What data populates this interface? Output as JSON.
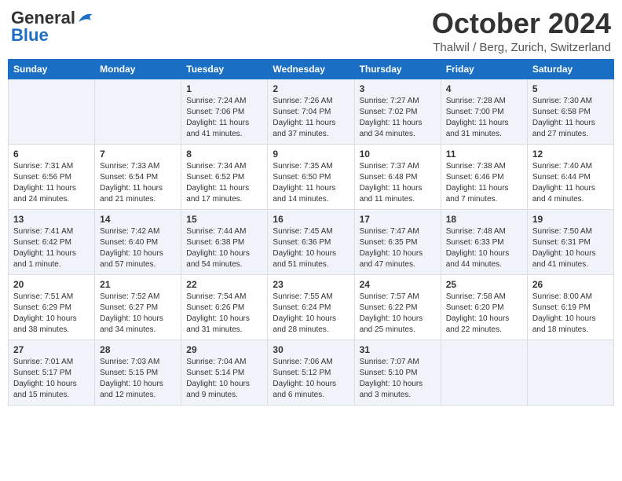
{
  "logo": {
    "general": "General",
    "blue": "Blue"
  },
  "title": "October 2024",
  "location": "Thalwil / Berg, Zurich, Switzerland",
  "days_of_week": [
    "Sunday",
    "Monday",
    "Tuesday",
    "Wednesday",
    "Thursday",
    "Friday",
    "Saturday"
  ],
  "weeks": [
    [
      {
        "day": "",
        "info": ""
      },
      {
        "day": "",
        "info": ""
      },
      {
        "day": "1",
        "info": "Sunrise: 7:24 AM\nSunset: 7:06 PM\nDaylight: 11 hours and 41 minutes."
      },
      {
        "day": "2",
        "info": "Sunrise: 7:26 AM\nSunset: 7:04 PM\nDaylight: 11 hours and 37 minutes."
      },
      {
        "day": "3",
        "info": "Sunrise: 7:27 AM\nSunset: 7:02 PM\nDaylight: 11 hours and 34 minutes."
      },
      {
        "day": "4",
        "info": "Sunrise: 7:28 AM\nSunset: 7:00 PM\nDaylight: 11 hours and 31 minutes."
      },
      {
        "day": "5",
        "info": "Sunrise: 7:30 AM\nSunset: 6:58 PM\nDaylight: 11 hours and 27 minutes."
      }
    ],
    [
      {
        "day": "6",
        "info": "Sunrise: 7:31 AM\nSunset: 6:56 PM\nDaylight: 11 hours and 24 minutes."
      },
      {
        "day": "7",
        "info": "Sunrise: 7:33 AM\nSunset: 6:54 PM\nDaylight: 11 hours and 21 minutes."
      },
      {
        "day": "8",
        "info": "Sunrise: 7:34 AM\nSunset: 6:52 PM\nDaylight: 11 hours and 17 minutes."
      },
      {
        "day": "9",
        "info": "Sunrise: 7:35 AM\nSunset: 6:50 PM\nDaylight: 11 hours and 14 minutes."
      },
      {
        "day": "10",
        "info": "Sunrise: 7:37 AM\nSunset: 6:48 PM\nDaylight: 11 hours and 11 minutes."
      },
      {
        "day": "11",
        "info": "Sunrise: 7:38 AM\nSunset: 6:46 PM\nDaylight: 11 hours and 7 minutes."
      },
      {
        "day": "12",
        "info": "Sunrise: 7:40 AM\nSunset: 6:44 PM\nDaylight: 11 hours and 4 minutes."
      }
    ],
    [
      {
        "day": "13",
        "info": "Sunrise: 7:41 AM\nSunset: 6:42 PM\nDaylight: 11 hours and 1 minute."
      },
      {
        "day": "14",
        "info": "Sunrise: 7:42 AM\nSunset: 6:40 PM\nDaylight: 10 hours and 57 minutes."
      },
      {
        "day": "15",
        "info": "Sunrise: 7:44 AM\nSunset: 6:38 PM\nDaylight: 10 hours and 54 minutes."
      },
      {
        "day": "16",
        "info": "Sunrise: 7:45 AM\nSunset: 6:36 PM\nDaylight: 10 hours and 51 minutes."
      },
      {
        "day": "17",
        "info": "Sunrise: 7:47 AM\nSunset: 6:35 PM\nDaylight: 10 hours and 47 minutes."
      },
      {
        "day": "18",
        "info": "Sunrise: 7:48 AM\nSunset: 6:33 PM\nDaylight: 10 hours and 44 minutes."
      },
      {
        "day": "19",
        "info": "Sunrise: 7:50 AM\nSunset: 6:31 PM\nDaylight: 10 hours and 41 minutes."
      }
    ],
    [
      {
        "day": "20",
        "info": "Sunrise: 7:51 AM\nSunset: 6:29 PM\nDaylight: 10 hours and 38 minutes."
      },
      {
        "day": "21",
        "info": "Sunrise: 7:52 AM\nSunset: 6:27 PM\nDaylight: 10 hours and 34 minutes."
      },
      {
        "day": "22",
        "info": "Sunrise: 7:54 AM\nSunset: 6:26 PM\nDaylight: 10 hours and 31 minutes."
      },
      {
        "day": "23",
        "info": "Sunrise: 7:55 AM\nSunset: 6:24 PM\nDaylight: 10 hours and 28 minutes."
      },
      {
        "day": "24",
        "info": "Sunrise: 7:57 AM\nSunset: 6:22 PM\nDaylight: 10 hours and 25 minutes."
      },
      {
        "day": "25",
        "info": "Sunrise: 7:58 AM\nSunset: 6:20 PM\nDaylight: 10 hours and 22 minutes."
      },
      {
        "day": "26",
        "info": "Sunrise: 8:00 AM\nSunset: 6:19 PM\nDaylight: 10 hours and 18 minutes."
      }
    ],
    [
      {
        "day": "27",
        "info": "Sunrise: 7:01 AM\nSunset: 5:17 PM\nDaylight: 10 hours and 15 minutes."
      },
      {
        "day": "28",
        "info": "Sunrise: 7:03 AM\nSunset: 5:15 PM\nDaylight: 10 hours and 12 minutes."
      },
      {
        "day": "29",
        "info": "Sunrise: 7:04 AM\nSunset: 5:14 PM\nDaylight: 10 hours and 9 minutes."
      },
      {
        "day": "30",
        "info": "Sunrise: 7:06 AM\nSunset: 5:12 PM\nDaylight: 10 hours and 6 minutes."
      },
      {
        "day": "31",
        "info": "Sunrise: 7:07 AM\nSunset: 5:10 PM\nDaylight: 10 hours and 3 minutes."
      },
      {
        "day": "",
        "info": ""
      },
      {
        "day": "",
        "info": ""
      }
    ]
  ]
}
